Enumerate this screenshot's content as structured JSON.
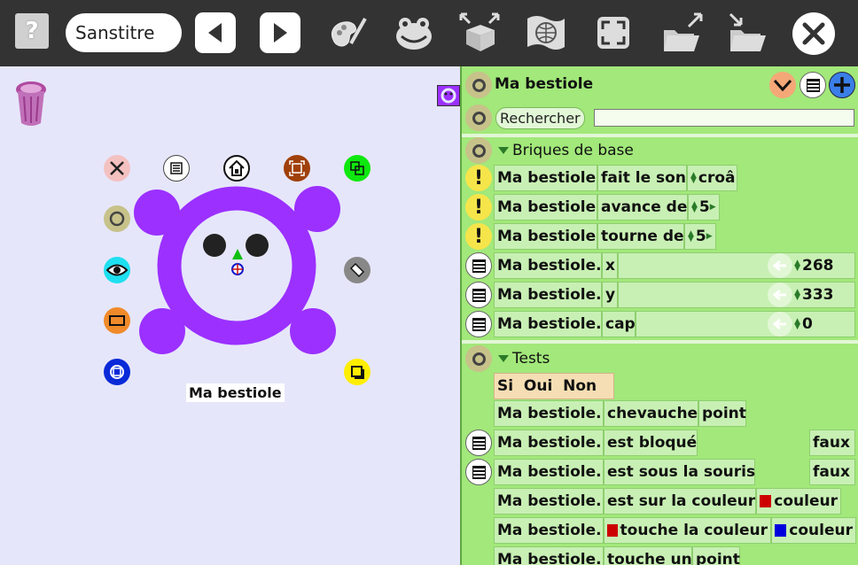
{
  "toolbar": {
    "help_glyph": "?",
    "project_title": "Sanstitre",
    "buttons": [
      "back-button",
      "forward-button",
      "paint-editor-button",
      "character-button",
      "import-export-button",
      "web-button",
      "fullscreen-button",
      "upload-button",
      "download-button",
      "close-button"
    ]
  },
  "sprite": {
    "name": "Ma bestiole",
    "body_color": "#9b30ff"
  },
  "palette": {
    "header_title": "Ma bestiole",
    "search_button": "Rechercher",
    "search_value": "",
    "sections": {
      "basic": {
        "title": "Briques de base",
        "rows": [
          {
            "actor": "Ma bestiole",
            "action": "fait le son",
            "value": "croâ"
          },
          {
            "actor": "Ma bestiole",
            "action": "avance de",
            "value": "5"
          },
          {
            "actor": "Ma bestiole",
            "action": "tourne de",
            "value": "5"
          },
          {
            "actor": "Ma bestiole.",
            "prop": "x",
            "value": "268"
          },
          {
            "actor": "Ma bestiole.",
            "prop": "y",
            "value": "333"
          },
          {
            "actor": "Ma bestiole.",
            "prop": "cap",
            "value": "0"
          }
        ]
      },
      "tests": {
        "title": "Tests",
        "ifbar": "Si  Oui  Non",
        "rows": [
          {
            "actor": "Ma bestiole.",
            "action": "chevauche",
            "extra": "point"
          },
          {
            "actor": "Ma bestiole.",
            "action": "est bloqué",
            "result": "faux"
          },
          {
            "actor": "Ma bestiole.",
            "action": "est sous la souris",
            "result": "faux"
          },
          {
            "actor": "Ma bestiole.",
            "action": "est sur la couleur",
            "extra": "couleur"
          },
          {
            "actor": "Ma bestiole.",
            "action": "touche la couleur",
            "extra": "couleur"
          },
          {
            "actor": "Ma bestiole.",
            "action": "touche un",
            "extra": "point"
          }
        ]
      }
    }
  },
  "colors": {
    "toolbar_bg": "#333333",
    "canvas_bg": "#e6e6fa",
    "palette_bg": "#a2e87a",
    "block_bg": "#c8f0b4",
    "swatch_red": "#cc0000",
    "swatch_blue": "#0000dd"
  }
}
